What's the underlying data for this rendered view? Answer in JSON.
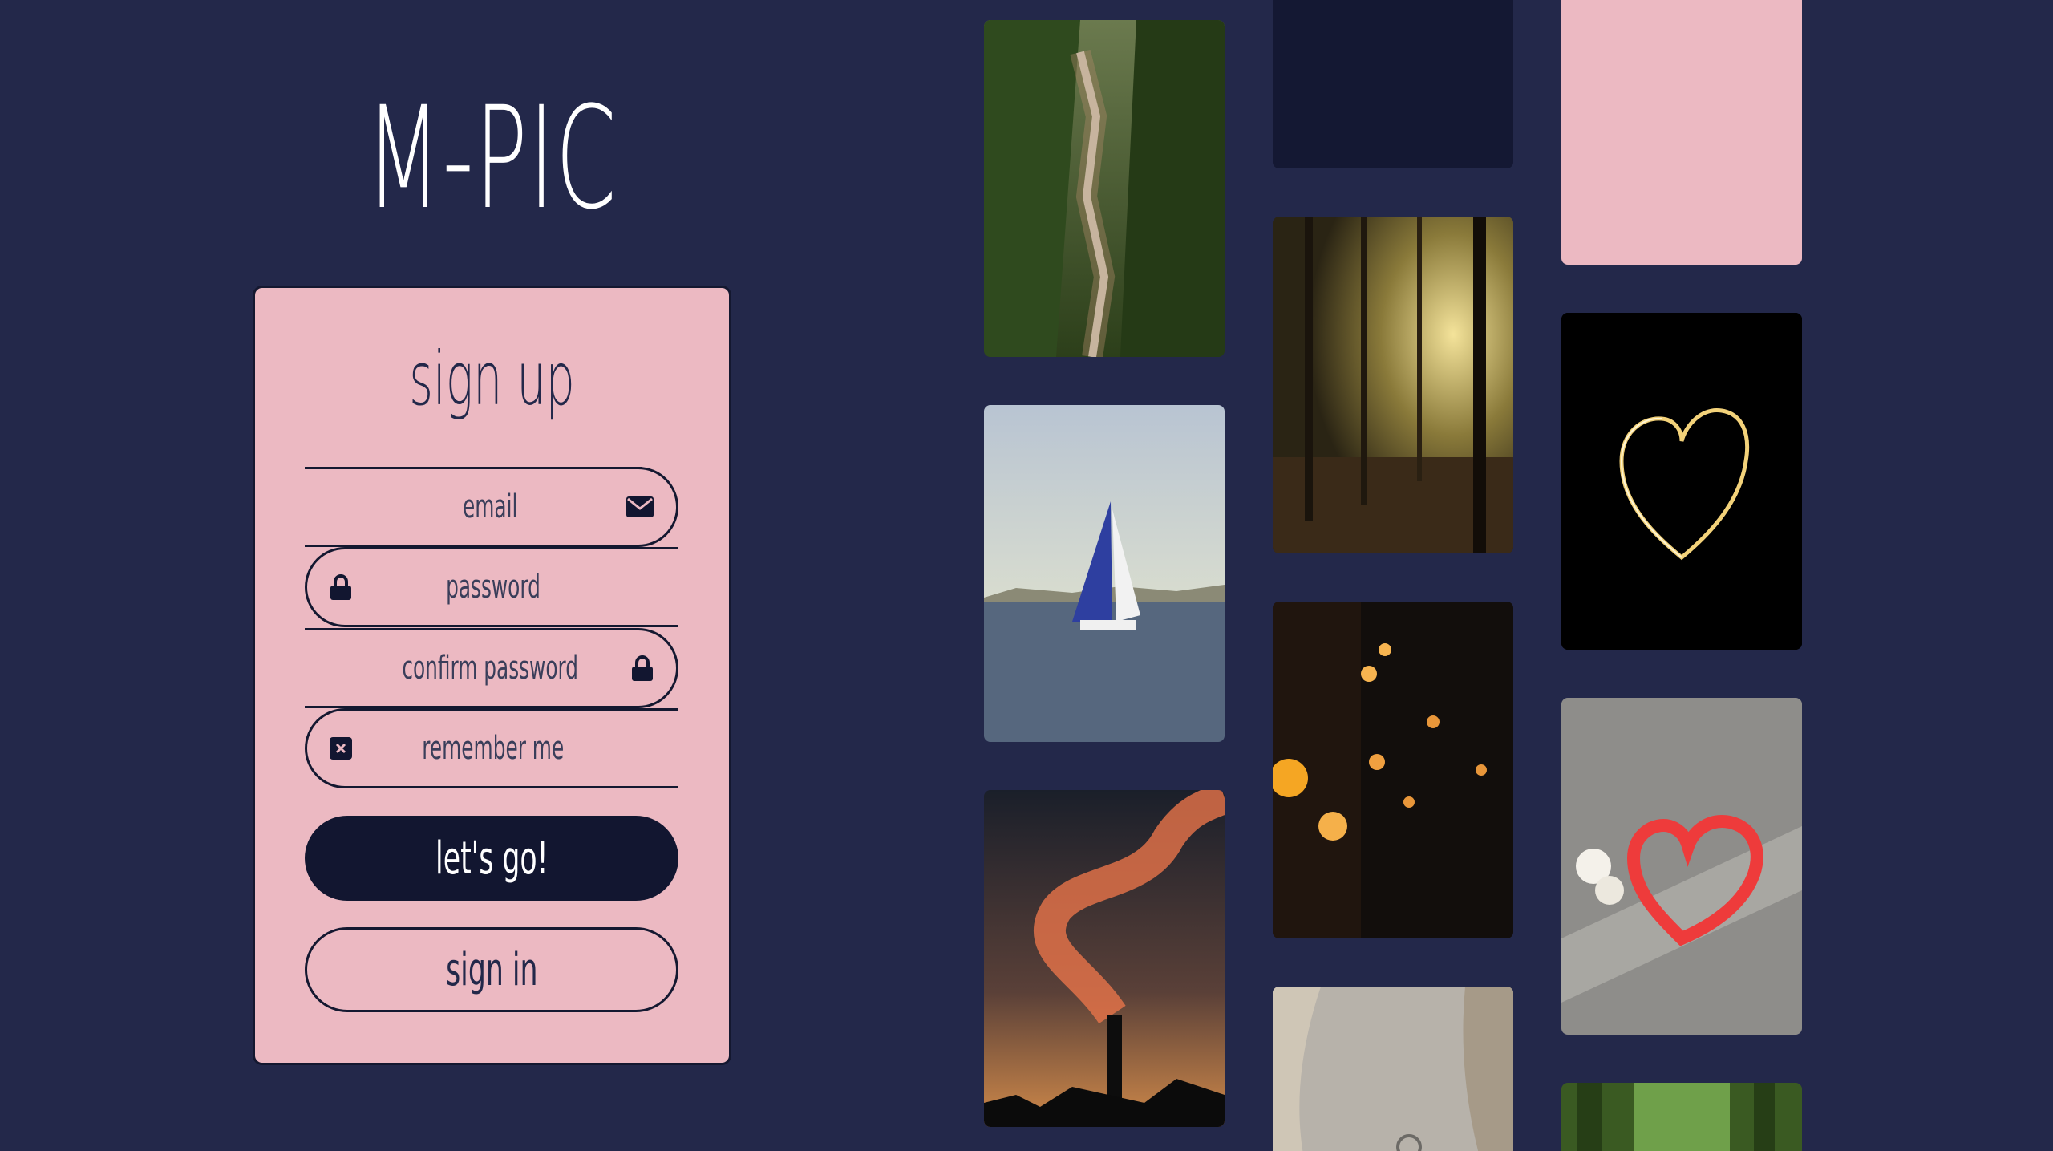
{
  "app": {
    "logo": "M-PIC"
  },
  "signup": {
    "title": "sign up",
    "email": {
      "placeholder": "email",
      "icon": "envelope-icon"
    },
    "password": {
      "placeholder": "password",
      "icon": "lock-icon"
    },
    "confirm_password": {
      "placeholder": "confirm password",
      "icon": "lock-icon"
    },
    "remember_me": {
      "label": "remember me",
      "icon": "checkbox-x-icon",
      "checked": false
    },
    "submit_label": "let's go!",
    "signin_label": "sign in"
  },
  "colors": {
    "background": "#23284a",
    "card": "#ecb9c2",
    "dark": "#121630",
    "placeholder_tile_dark": "#141833",
    "placeholder_tile_pink": "#ecb9c2"
  },
  "gallery": [
    {
      "name": "waterfall-forest-photo"
    },
    {
      "name": "dark-placeholder-tile"
    },
    {
      "name": "pink-placeholder-tile"
    },
    {
      "name": "sunlit-forest-photo"
    },
    {
      "name": "sailboat-photo"
    },
    {
      "name": "light-heart-photo"
    },
    {
      "name": "string-lights-photo"
    },
    {
      "name": "smoke-chimney-sunset-photo"
    },
    {
      "name": "chalk-heart-photo"
    },
    {
      "name": "stone-closeup-photo"
    },
    {
      "name": "green-forest-photo"
    }
  ]
}
